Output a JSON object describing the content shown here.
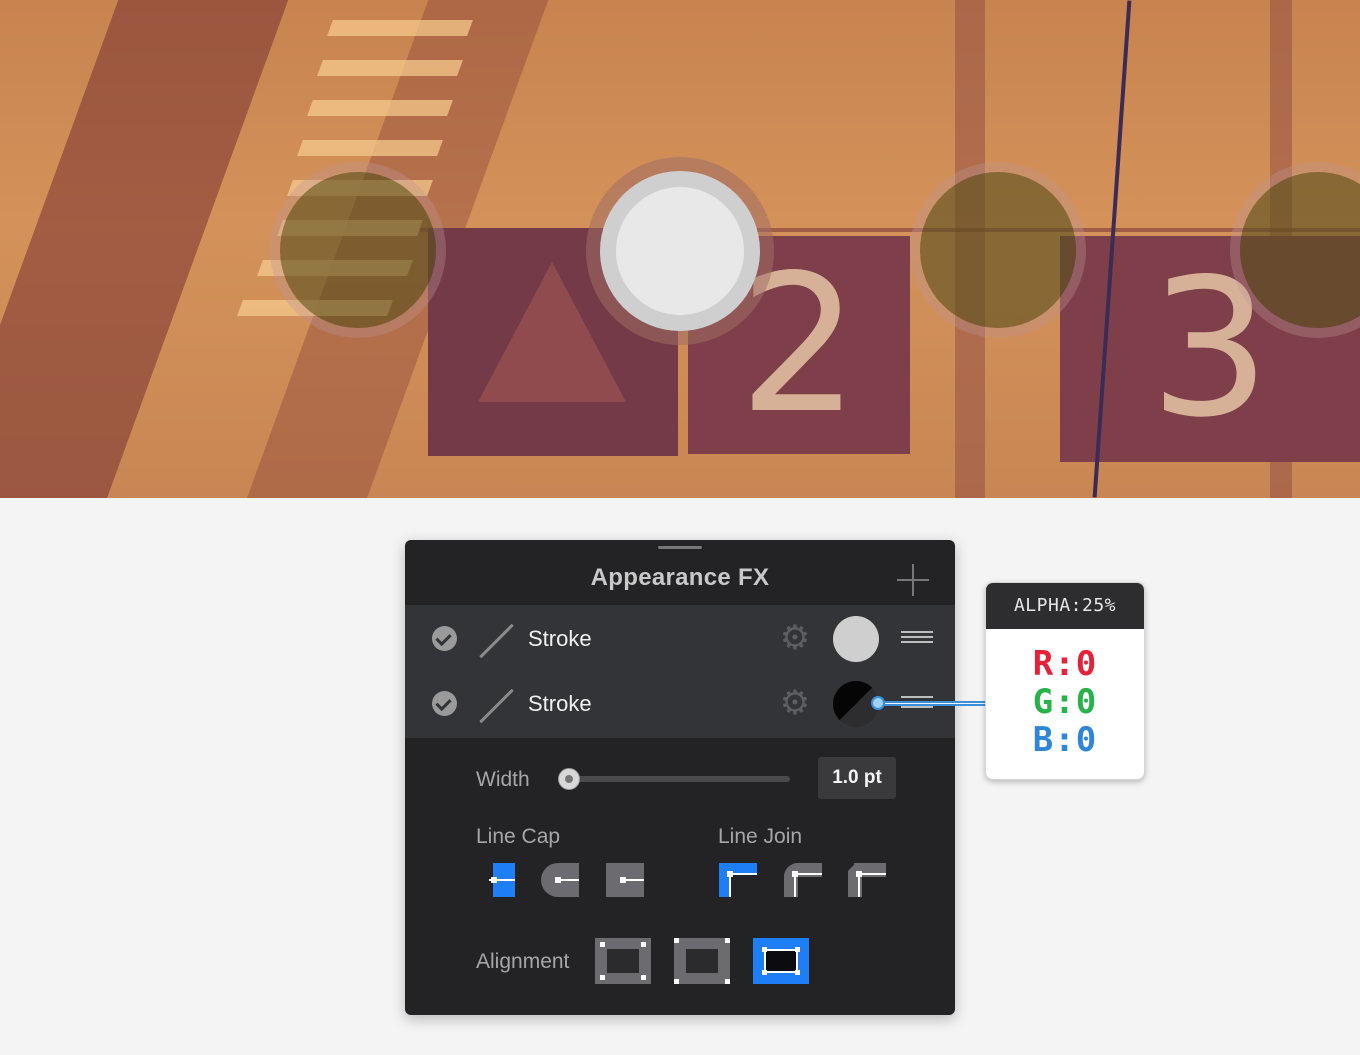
{
  "panel": {
    "title": "Appearance FX",
    "strokes": [
      {
        "label": "Stroke",
        "color": "#cfcfcf",
        "enabled": true
      },
      {
        "label": "Stroke",
        "color": "#000000",
        "enabled": true
      }
    ],
    "width_label": "Width",
    "width_value": "1.0 pt",
    "width_level": 0.0,
    "line_cap_label": "Line Cap",
    "line_join_label": "Line Join",
    "alignment_label": "Alignment",
    "line_cap_selected": "butt",
    "line_join_selected": "miter",
    "alignment_selected": "outside",
    "accent_color": "#1e7ef6"
  },
  "tooltip": {
    "alpha": "ALPHA:25%",
    "r": "R:0",
    "g": "G:0",
    "b": "B:0",
    "r_color": "#e8213a",
    "g_color": "#27b24a",
    "b_color": "#2f86d8"
  },
  "photo": {
    "sign_2": "2",
    "sign_3": "3"
  }
}
